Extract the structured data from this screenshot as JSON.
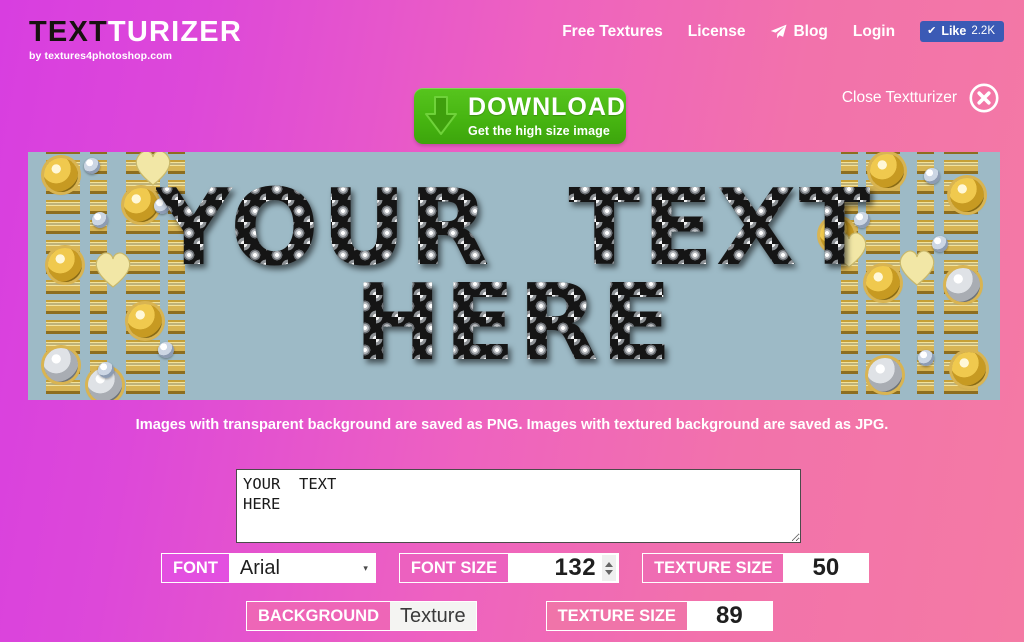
{
  "site": {
    "logo_primary": "TEXT",
    "logo_secondary": "TURIZER",
    "logo_subtitle": "by textures4photoshop.com"
  },
  "nav": {
    "items": [
      {
        "label": "Free Textures",
        "icon": ""
      },
      {
        "label": "License",
        "icon": ""
      },
      {
        "label": "Blog",
        "icon": "paper-plane-icon"
      },
      {
        "label": "Login",
        "icon": ""
      }
    ],
    "like": {
      "check": "✔",
      "label": "Like",
      "count": "2.2K",
      "color": "#3b5ab5"
    }
  },
  "download": {
    "title": "DOWNLOAD",
    "subtitle": "Get the high size image",
    "icon": "download-arrow-icon",
    "color": "#46b411"
  },
  "close": {
    "label": "Close Textturizer",
    "icon": "close-circle-icon"
  },
  "preview": {
    "line1": "YOUR  TEXT",
    "line2": "HERE",
    "background_color": "#9dbac6"
  },
  "info": {
    "text": "Images with transparent background are saved as PNG. Images with textured background are saved as JPG."
  },
  "editor": {
    "textarea_value": "YOUR  TEXT\nHERE",
    "textarea_placeholder": "YOUR TEXT HERE"
  },
  "controls": {
    "font": {
      "label": "FONT",
      "value": "Arial",
      "caret": "▾"
    },
    "font_size": {
      "label": "FONT SIZE",
      "value": "132"
    },
    "texture_size_1": {
      "label": "TEXTURE SIZE",
      "value": "50"
    },
    "background": {
      "label": "BACKGROUND",
      "value": "Texture"
    },
    "texture_size_2": {
      "label": "TEXTURE SIZE",
      "value": "89"
    }
  },
  "theme": {
    "bg_left": "#d83ee0",
    "bg_right": "#f47aa4",
    "label_magenta": "#e34fe0",
    "label_pink": "#f074a9"
  }
}
